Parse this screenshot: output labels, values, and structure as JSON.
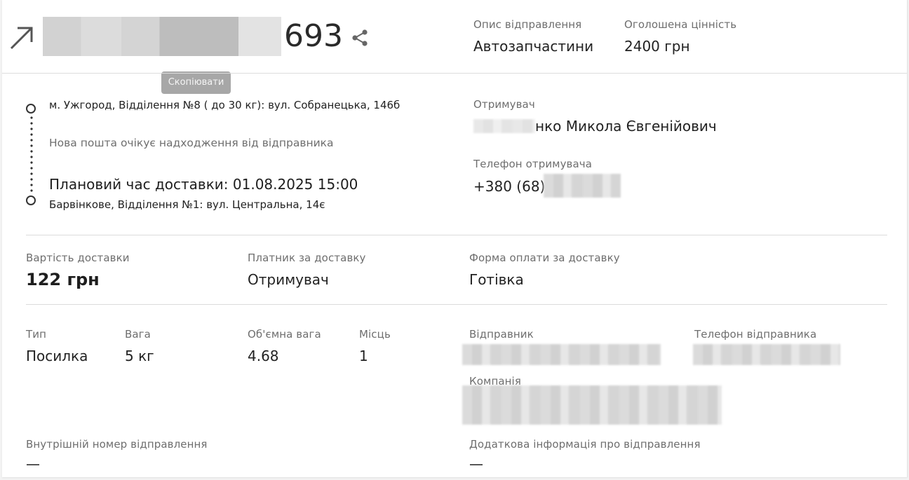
{
  "header": {
    "ttn_suffix": "693",
    "copy_tooltip": "Скопіювати",
    "description_label": "Опис відправлення",
    "description_value": "Автозапчастини",
    "declared_label": "Оголошена цінність",
    "declared_value": "2400 грн"
  },
  "route": {
    "from": "м. Ужгород, Відділення №8 ( до 30 кг): вул. Собранецька, 146б",
    "status": "Нова пошта очікує надходження від відправника",
    "planned": "Плановий час доставки: 01.08.2025 15:00",
    "to": "Барвінкове, Відділення №1: вул. Центральна, 14є"
  },
  "recipient": {
    "label": "Отримувач",
    "name_visible": "нко Микола Євгенійович",
    "phone_label": "Телефон отримувача",
    "phone_visible": "+380 (68)"
  },
  "payment": {
    "cost_label": "Вартість доставки",
    "cost_value": "122 грн",
    "payer_label": "Платник за доставку",
    "payer_value": "Отримувач",
    "form_label": "Форма оплати за доставку",
    "form_value": "Готівка"
  },
  "parcel": {
    "type_label": "Тип",
    "type_value": "Посилка",
    "weight_label": "Вага",
    "weight_value": "5 кг",
    "volume_label": "Об'ємна вага",
    "volume_value": "4.68",
    "places_label": "Місць",
    "places_value": "1"
  },
  "sender": {
    "label": "Відправник",
    "phone_label": "Телефон відправника",
    "company_label": "Компанія"
  },
  "extra": {
    "internal_label": "Внутрішній номер відправлення",
    "internal_value": "—",
    "info_label": "Додаткова інформація про відправлення",
    "info_value": "—"
  }
}
